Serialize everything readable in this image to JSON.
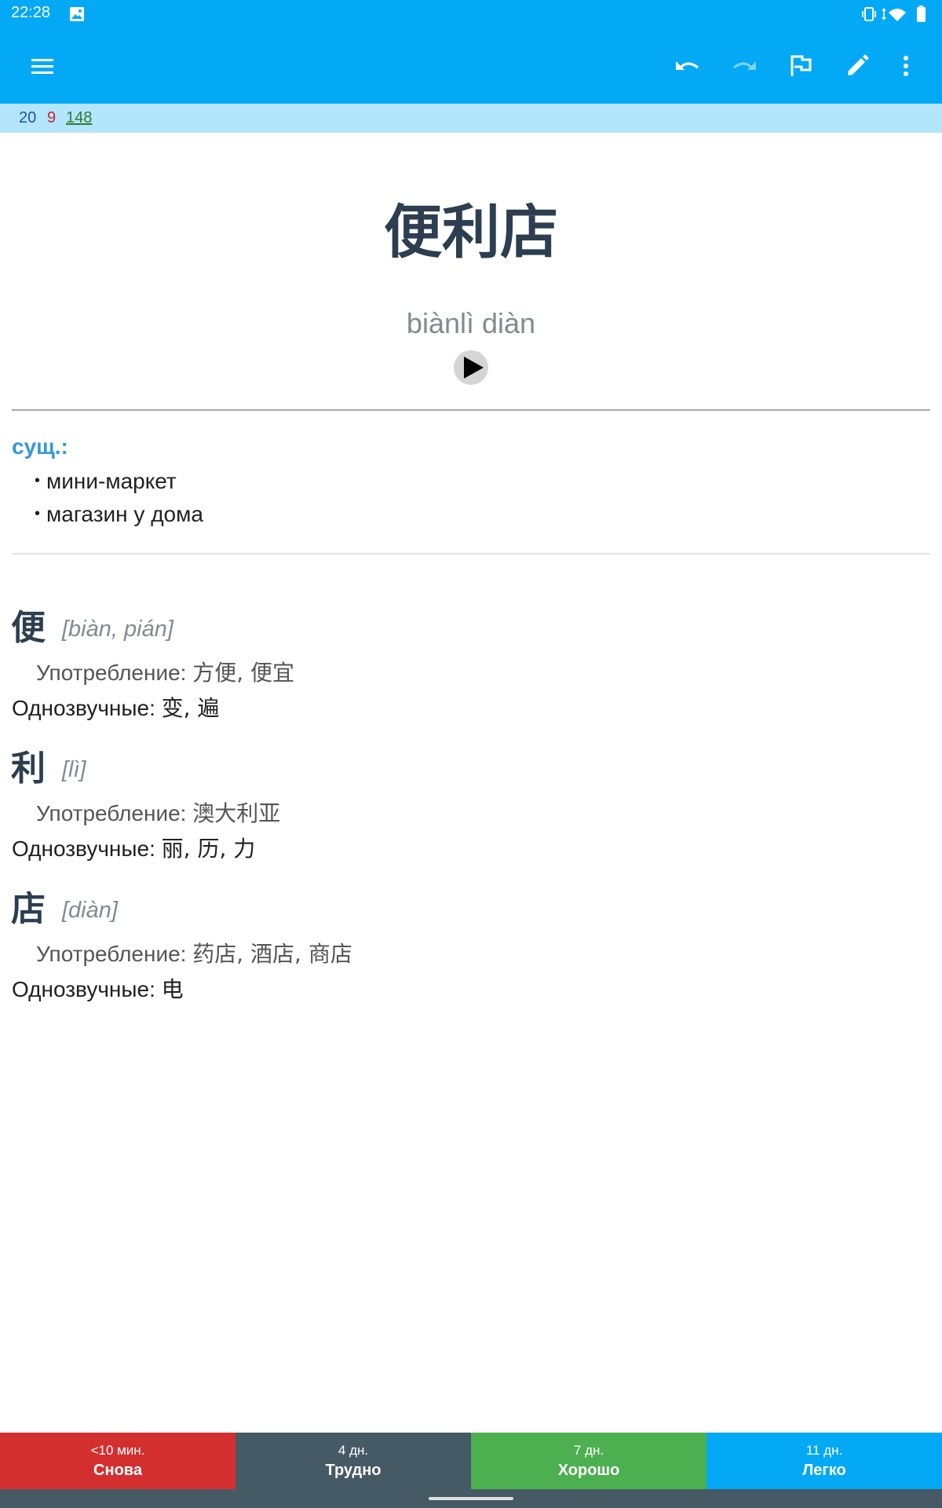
{
  "status": {
    "time": "22:28",
    "icons": [
      "image-icon",
      "vibrate-icon",
      "data-arrows-icon",
      "wifi-icon",
      "battery-icon"
    ]
  },
  "toolbar": {
    "icons": [
      "menu-icon",
      "undo-icon",
      "redo-icon",
      "flag-icon",
      "edit-icon",
      "overflow-icon"
    ],
    "color": "#03a9f4"
  },
  "counts": {
    "new": "20",
    "learning": "9",
    "review": "148"
  },
  "card": {
    "word": "便利店",
    "pinyin": "biànlì diàn",
    "pos": "сущ.:",
    "definitions": [
      "мини-маркет",
      "магазин у дома"
    ],
    "characters": [
      {
        "char": "便",
        "pinyin": "[biàn, pián]",
        "usage_label": "Употребление:",
        "usage": "方便, 便宜",
        "homophones_label": "Однозвучные:",
        "homophones": "变, 遍"
      },
      {
        "char": "利",
        "pinyin": "[lì]",
        "usage_label": "Употребление:",
        "usage": "澳大利亚",
        "homophones_label": "Однозвучные:",
        "homophones": "丽, 历, 力"
      },
      {
        "char": "店",
        "pinyin": "[diàn]",
        "usage_label": "Употребление:",
        "usage": "药店, 酒店, 商店",
        "homophones_label": "Однозвучные:",
        "homophones": "电"
      }
    ]
  },
  "answers": [
    {
      "time": "<10 мин.",
      "label": "Снова",
      "color": "#d32f2f"
    },
    {
      "time": "4 дн.",
      "label": "Трудно",
      "color": "#455a64"
    },
    {
      "time": "7 дн.",
      "label": "Хорошо",
      "color": "#4caf50"
    },
    {
      "time": "11 дн.",
      "label": "Легко",
      "color": "#03a9f4"
    }
  ]
}
